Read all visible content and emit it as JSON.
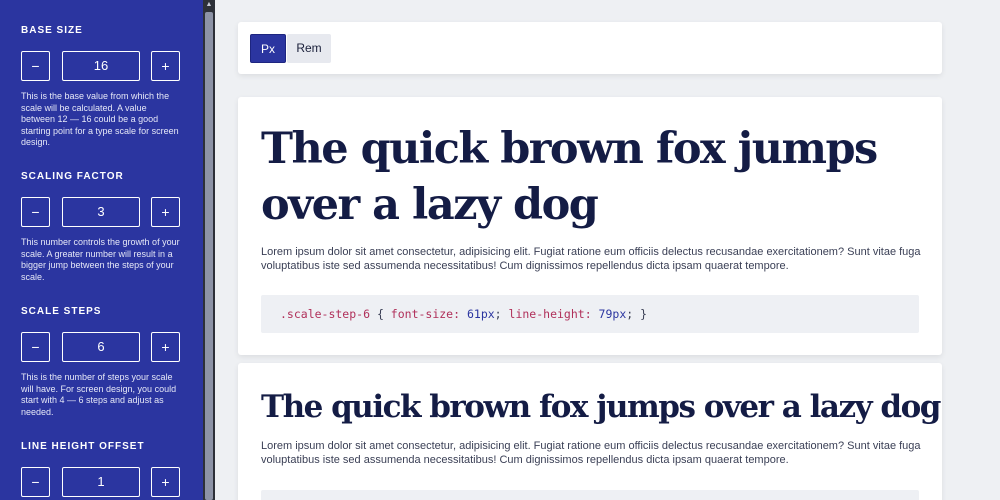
{
  "sidebar": {
    "sections": [
      {
        "label": "BASE SIZE",
        "value": "16",
        "minus": "−",
        "plus": "+",
        "help": "This is the base value from which the scale will be calculated. A value between 12 — 16 could be a good starting point for a type scale for screen design."
      },
      {
        "label": "SCALING FACTOR",
        "value": "3",
        "minus": "−",
        "plus": "+",
        "help": "This number controls the growth of your scale. A greater number will result in a bigger jump between the steps of your scale."
      },
      {
        "label": "SCALE STEPS",
        "value": "6",
        "minus": "−",
        "plus": "+",
        "help": "This is the number of steps your scale will have. For screen design, you could start with 4 — 6 steps and adjust as needed."
      },
      {
        "label": "LINE HEIGHT OFFSET",
        "value": "1",
        "minus": "−",
        "plus": "+"
      }
    ],
    "scroll_up_glyph": "▲"
  },
  "toolbar": {
    "px_label": "Px",
    "rem_label": "Rem",
    "active": "Px"
  },
  "cards": [
    {
      "headline": "The quick brown fox jumps over a lazy dog",
      "lorem": "Lorem ipsum dolor sit amet consectetur, adipisicing elit. Fugiat ratione eum officiis delectus recusandae exercitationem? Sunt vitae fuga voluptatibus iste sed assumenda necessitatibus! Cum dignissimos repellendus dicta ipsam quaerat tempore.",
      "code": {
        "selector": ".scale-step-6",
        "open": " { ",
        "prop1": "font-size:",
        "val1": " 61px",
        "sep": "; ",
        "prop2": "line-height:",
        "val2": " 79px",
        "close": "; }"
      }
    },
    {
      "headline": "The quick brown fox jumps over a lazy dog",
      "lorem": "Lorem ipsum dolor sit amet consectetur, adipisicing elit. Fugiat ratione eum officiis delectus recusandae exercitationem? Sunt vitae fuga voluptatibus iste sed assumenda necessitatibus! Cum dignissimos repellendus dicta ipsam quaerat tempore."
    }
  ],
  "colors": {
    "sidebar_bg": "#2b35a0",
    "headline": "#141c45",
    "code_selector": "#b0305a",
    "code_value": "#2b35a0"
  }
}
